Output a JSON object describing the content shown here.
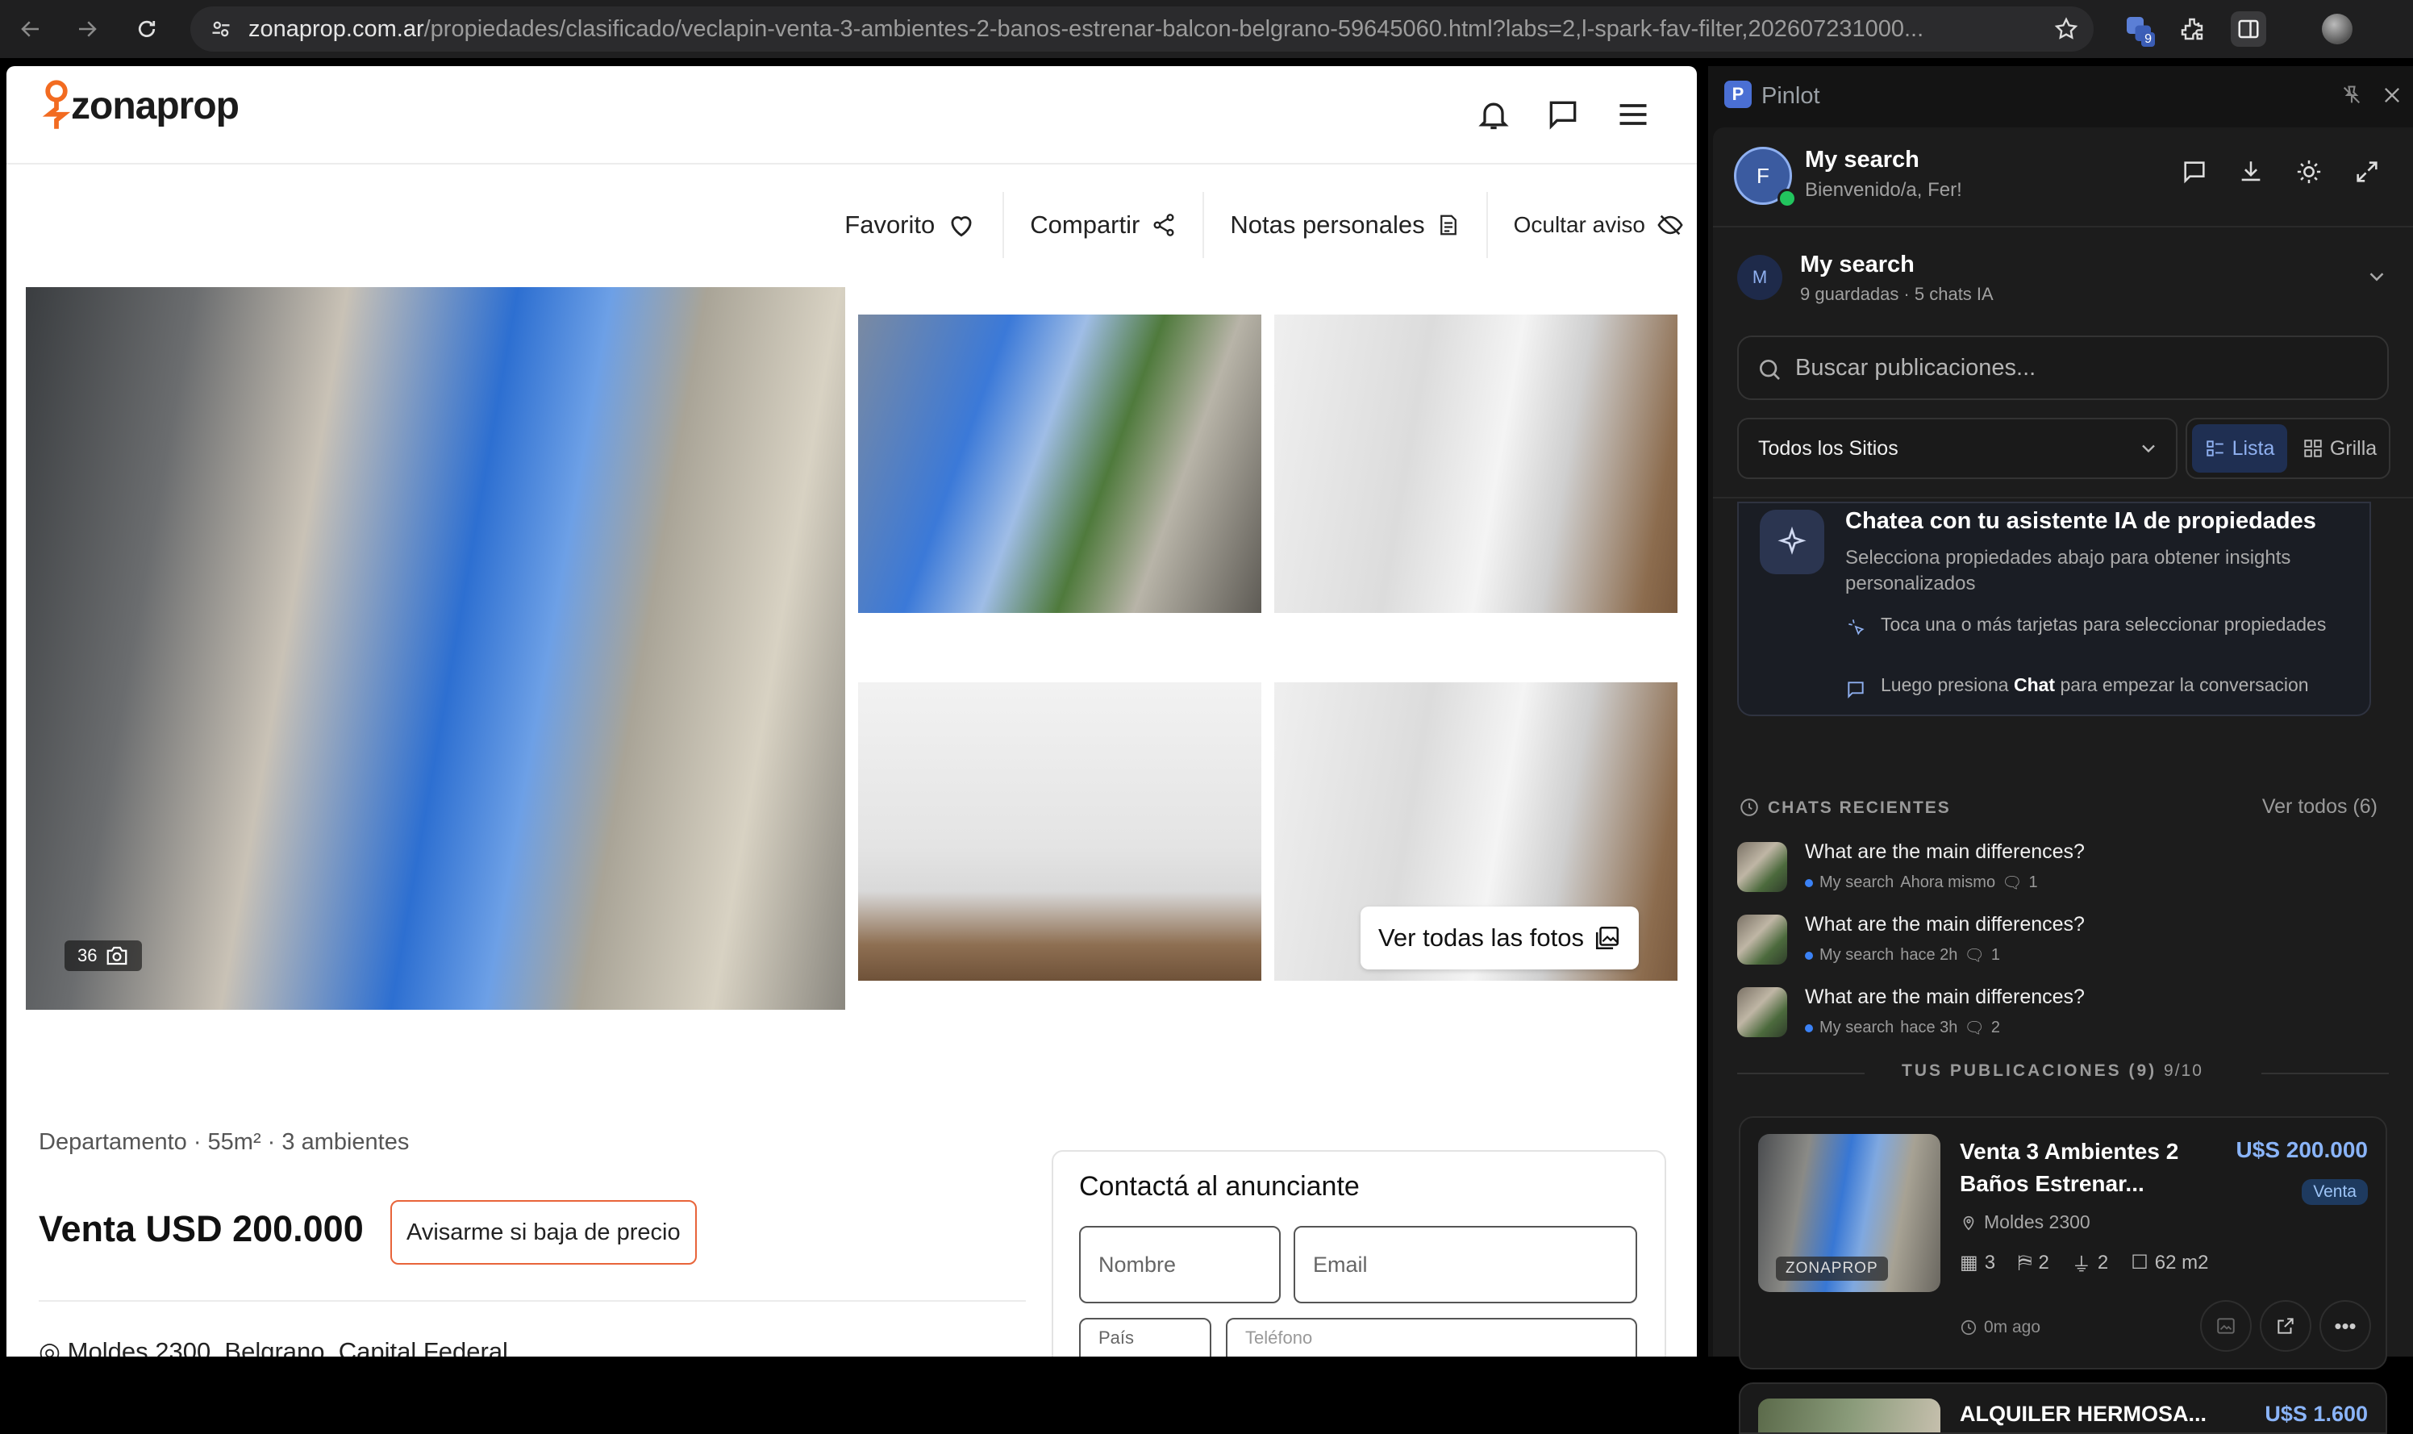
{
  "browser": {
    "url_domain": "zonaprop.com.ar",
    "url_path": "/propiedades/clasificado/veclapin-venta-3-ambientes-2-banos-estrenar-balcon-belgrano-59645060.html?labs=2,l-spark-fav-filter,202607231000...",
    "extension_badge": "9"
  },
  "site": {
    "logo": "zonaprop",
    "actions": {
      "favorite": "Favorito",
      "share": "Compartir",
      "notes": "Notas personales",
      "hide": "Ocultar aviso"
    },
    "photo_count": "36",
    "see_all_photos": "Ver todas las fotos",
    "property_summary": "Departamento · 55m² · 3 ambientes",
    "price": "Venta USD 200.000",
    "price_alert_button": "Avisarme si baja de precio",
    "address_partial": "Moldes 2300, Belgrano, Capital Federal",
    "contact": {
      "title": "Contactá al anunciante",
      "name_placeholder": "Nombre",
      "email_placeholder": "Email",
      "country_label": "País",
      "phone_placeholder": "Teléfono"
    }
  },
  "panel": {
    "app_name": "Pinlot",
    "user": {
      "avatar_letter": "F",
      "title": "My search",
      "greeting": "Bienvenido/a, Fer!"
    },
    "workspace": {
      "avatar_letter": "M",
      "name": "My search",
      "meta": "9 guardadas · 5 chats IA"
    },
    "search_placeholder": "Buscar publicaciones...",
    "site_filter": "Todos los Sitios",
    "view_list": "Lista",
    "view_grid": "Grilla",
    "ai_card": {
      "title": "Chatea con tu asistente IA de propiedades",
      "subtitle": "Selecciona propiedades abajo para obtener insights personalizados",
      "step1": "Toca una o más tarjetas para seleccionar propiedades",
      "step2_pre": "Luego presiona ",
      "step2_bold": "Chat",
      "step2_post": " para empezar la conversacion"
    },
    "recent_chats_label": "CHATS RECIENTES",
    "see_all": "Ver todos (6)",
    "chats": [
      {
        "title": "What are the main differences?",
        "search": "My search",
        "time": "Ahora mismo",
        "count": "1"
      },
      {
        "title": "What are the main differences?",
        "search": "My search",
        "time": "hace 2h",
        "count": "1"
      },
      {
        "title": "What are the main differences?",
        "search": "My search",
        "time": "hace 3h",
        "count": "2"
      }
    ],
    "listings_header": "TUS PUBLICACIONES (9)",
    "listings_count": "9/10",
    "listing": {
      "title": "Venta 3 Ambientes 2 Baños Estrenar...",
      "price": "U$S 200.000",
      "badge": "Venta",
      "address": "Moldes 2300",
      "source": "ZONAPROP",
      "rooms": "3",
      "bedrooms": "2",
      "baths": "2",
      "area": "62 m2",
      "age": "0m ago"
    },
    "next_listing_title": "ALQUILER HERMOSA...",
    "next_listing_price": "U$S 1.600"
  },
  "colors": {
    "accent_orange": "#e8643a",
    "panel_bg": "#1c1c1c",
    "accent_blue": "#3b82f6",
    "price_blue": "#8ab4f8"
  }
}
